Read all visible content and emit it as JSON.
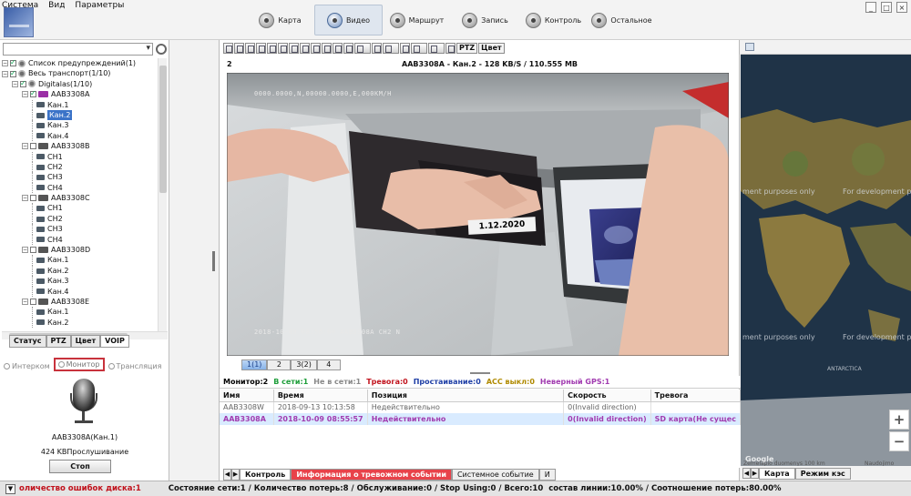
{
  "menu": [
    "Система",
    "Вид",
    "Параметры"
  ],
  "nav_tabs": [
    {
      "label": "Карта",
      "icon": "map-icon"
    },
    {
      "label": "Видео",
      "icon": "video-icon",
      "active": true
    },
    {
      "label": "Маршрут",
      "icon": "route-icon"
    },
    {
      "label": "Запись",
      "icon": "record-icon"
    },
    {
      "label": "Контроль",
      "icon": "control-icon"
    },
    {
      "label": "Остальное",
      "icon": "other-icon"
    }
  ],
  "tree": [
    {
      "label": "Список предупреждений(1)",
      "level": 0
    },
    {
      "label": "Весь транспорт(1/10)",
      "level": 0
    },
    {
      "label": "Digitalas(1/10)",
      "level": 1
    },
    {
      "label": "AAB3308A",
      "level": 2,
      "online": true
    },
    {
      "label": "Кан.1",
      "level": 3
    },
    {
      "label": "Кан.2",
      "level": 3,
      "selected": true
    },
    {
      "label": "Кан.3",
      "level": 3
    },
    {
      "label": "Кан.4",
      "level": 3
    },
    {
      "label": "AAB3308B",
      "level": 2
    },
    {
      "label": "CH1",
      "level": 3
    },
    {
      "label": "CH2",
      "level": 3
    },
    {
      "label": "CH3",
      "level": 3
    },
    {
      "label": "CH4",
      "level": 3
    },
    {
      "label": "AAB3308C",
      "level": 2
    },
    {
      "label": "CH1",
      "level": 3
    },
    {
      "label": "CH2",
      "level": 3
    },
    {
      "label": "CH3",
      "level": 3
    },
    {
      "label": "CH4",
      "level": 3
    },
    {
      "label": "AAB3308D",
      "level": 2
    },
    {
      "label": "Кан.1",
      "level": 3
    },
    {
      "label": "Кан.2",
      "level": 3
    },
    {
      "label": "Кан.3",
      "level": 3
    },
    {
      "label": "Кан.4",
      "level": 3
    },
    {
      "label": "AAB3308E",
      "level": 2
    },
    {
      "label": "Кан.1",
      "level": 3
    },
    {
      "label": "Кан.2",
      "level": 3
    }
  ],
  "left_tabs": [
    "Статус",
    "PTZ",
    "Цвет",
    "VOIP"
  ],
  "voip": {
    "radios": [
      "Интерком",
      "Монитор",
      "Трансляция"
    ],
    "channel": "AAB3308A(Кан.1)",
    "info": "424 KBПрослушивание",
    "stop": "Стоп"
  },
  "video_toolbar": {
    "ptz": "PTZ",
    "color": "Цвет"
  },
  "video": {
    "window_num": "2",
    "title": "AAB3308A - Кан.2 - 128 KB/S / 110.555 MB",
    "osd_top": "0000.0000,N,00000.0000,E,000KM/H",
    "osd_bottom": "2018-10-09 08:56:00 AAB3308A CH2 N",
    "date_label": "1.12.2020"
  },
  "pages": [
    "1(1)",
    "2",
    "3(2)",
    "4"
  ],
  "monitor_bar": [
    {
      "text": "Монитор:2",
      "color": "#000000"
    },
    {
      "text": "В сети:1",
      "color": "#1e9e3a"
    },
    {
      "text": "Не в сети:1",
      "color": "#888888"
    },
    {
      "text": "Тревога:0",
      "color": "#c1121c"
    },
    {
      "text": "Простаивание:0",
      "color": "#1f3fa6"
    },
    {
      "text": "ACC выкл:0",
      "color": "#b08a00"
    },
    {
      "text": "Неверный GPS:1",
      "color": "#a13bb0"
    }
  ],
  "grid": {
    "columns": [
      "Имя",
      "Время",
      "Позиция",
      "Скорость",
      "Тревога"
    ],
    "rows": [
      [
        "AAB3308W",
        "2018-09-13 10:13:58",
        "Недействительно",
        "0(Invalid direction)",
        ""
      ],
      [
        "AAB3308A",
        "2018-10-09 08:55:57",
        "Недействительно",
        "0(Invalid direction)",
        "SD карта(Не сущес"
      ]
    ]
  },
  "bottom_tabs": [
    "Контроль",
    "Информация о тревожном событии",
    "Системное событие"
  ],
  "map": {
    "watermark": "For development purposes only",
    "watermark_left": "ment purposes only",
    "labels": [
      "ANTARCTICA",
      "Карта",
      "Режим кэс"
    ],
    "google": "Google",
    "copyright": "Zemelapio duomenys",
    "scale": "100 km",
    "terms": "Naudojimo sąlygos",
    "zoom_in": "+",
    "zoom_out": "−",
    "footer_tabs": [
      "Карта",
      "Режим кэс"
    ]
  },
  "status_bar": {
    "errors": "оличество ошибок диска:1",
    "stats": "Состояние сети:1 / Количество потерь:8 / Обслуживание:0 / Stop Using:0 / Всего:10",
    "stats2": "состав линии:10.00% / Соотношение потерь:80.00%"
  }
}
